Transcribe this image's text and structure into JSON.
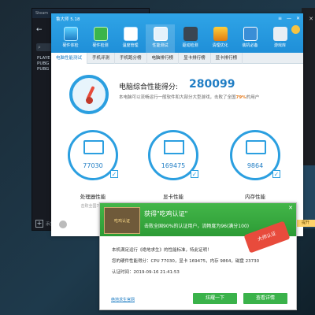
{
  "steam": {
    "title": "Steam",
    "list": [
      "PLAYE",
      "PUBG",
      "PUBG"
    ],
    "add_label": "添加"
  },
  "master": {
    "title": "鲁大师 5.18",
    "tools": [
      {
        "label": "硬件体检"
      },
      {
        "label": "硬件检测"
      },
      {
        "label": "温度管理"
      },
      {
        "label": "性能测试"
      },
      {
        "label": "驱动检测"
      },
      {
        "label": "清理优化"
      },
      {
        "label": "装机必备"
      },
      {
        "label": "游戏库"
      }
    ],
    "tabs": [
      "电脑性能测试",
      "手机评测",
      "手机跑分榜",
      "电脑排行榜",
      "显卡排行榜",
      "显卡排行榜"
    ],
    "score_label": "电脑综合性能得分:",
    "score": "280099",
    "score_desc_prefix": "本电脑可以流畅运行一般软件和大部分大型游戏，击败了全国",
    "score_pct": "79%",
    "score_desc_suffix": "的用户",
    "cards": [
      {
        "name": "cpu",
        "value": "77030",
        "label": "处理器性能",
        "sub": "击败全国72%"
      },
      {
        "name": "gpu",
        "value": "169475",
        "label": "显卡性能",
        "sub": ""
      },
      {
        "name": "mem",
        "value": "9864",
        "label": "内存性能",
        "sub": ""
      }
    ],
    "upgrade": "提升"
  },
  "popup": {
    "badge": "吃鸡认证",
    "title": "获得\"吃鸡认证\"",
    "subtitle": "击败全国90%的认证用户，流畅度为96(满分100)",
    "seal": "大师认证",
    "lines": [
      "本机满足运行《绝地求生》的性能标准，特此证明！",
      "您的硬件性能得分：CPU 77030，显卡 169475，内存 9864，磁盘 23730",
      "认证时间：2019-09-16 21:41:53"
    ],
    "link": "绝地求生官网",
    "btn_share": "炫耀一下",
    "btn_detail": "查看详情"
  }
}
